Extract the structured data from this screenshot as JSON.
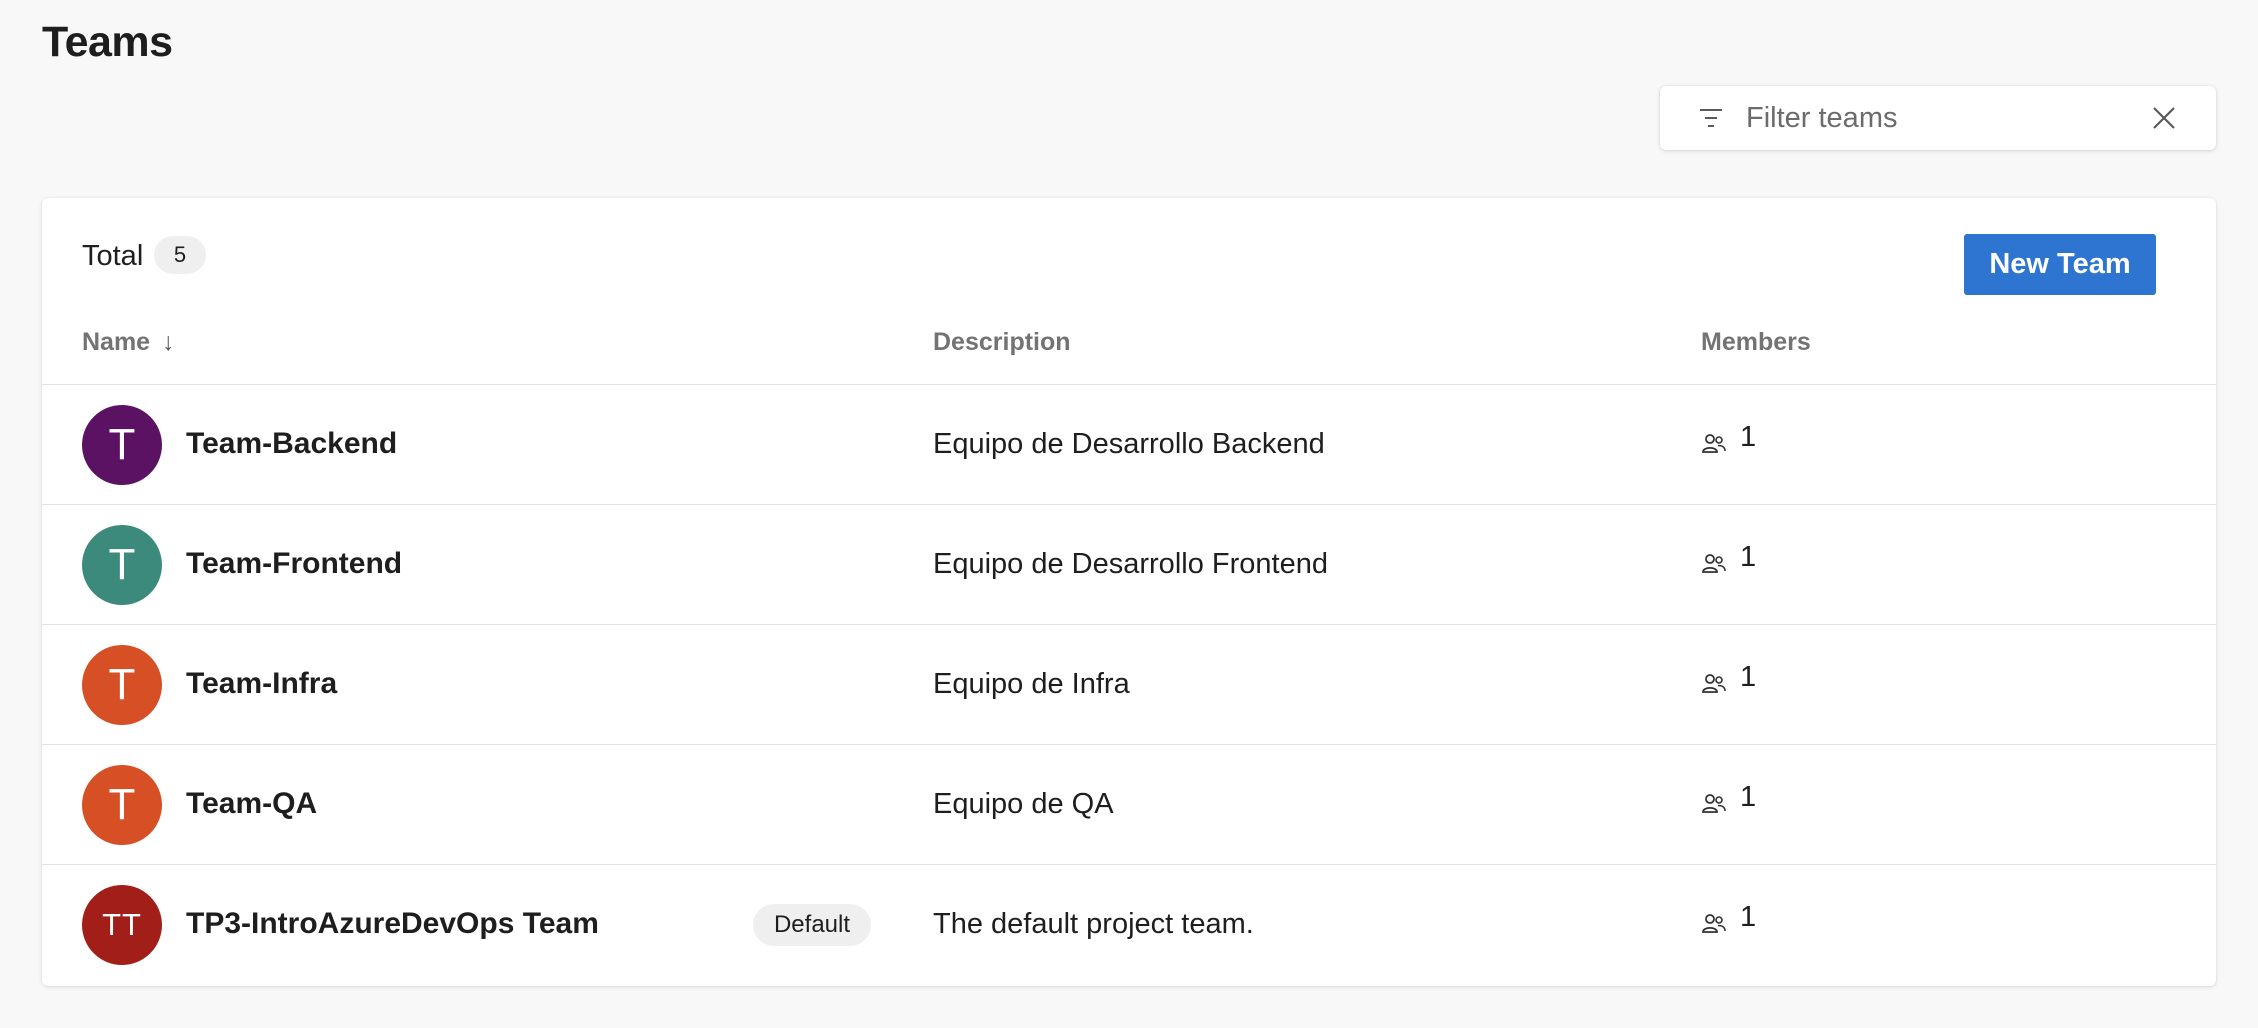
{
  "page": {
    "title": "Teams"
  },
  "filter": {
    "placeholder": "Filter teams",
    "value": "",
    "icon": "filter-icon",
    "clear_icon": "close-icon"
  },
  "summary": {
    "total_label": "Total",
    "total_count": "5"
  },
  "toolbar": {
    "new_team_label": "New Team",
    "accent_color": "#2d75d0"
  },
  "columns": {
    "name": "Name",
    "name_sort_indicator": "↓",
    "description": "Description",
    "members": "Members"
  },
  "teams": [
    {
      "initials": "T",
      "avatar_color": "#5c1263",
      "name": "Team-Backend",
      "badge": "",
      "description": "Equipo de Desarrollo Backend",
      "members": "1"
    },
    {
      "initials": "T",
      "avatar_color": "#3b8a7b",
      "name": "Team-Frontend",
      "badge": "",
      "description": "Equipo de Desarrollo Frontend",
      "members": "1"
    },
    {
      "initials": "T",
      "avatar_color": "#d64f25",
      "name": "Team-Infra",
      "badge": "",
      "description": "Equipo de Infra",
      "members": "1"
    },
    {
      "initials": "T",
      "avatar_color": "#d64f25",
      "name": "Team-QA",
      "badge": "",
      "description": "Equipo de QA",
      "members": "1"
    },
    {
      "initials": "TT",
      "avatar_color": "#a21e19",
      "name": "TP3-IntroAzureDevOps Team",
      "badge": "Default",
      "description": "The default project team.",
      "members": "1"
    }
  ]
}
